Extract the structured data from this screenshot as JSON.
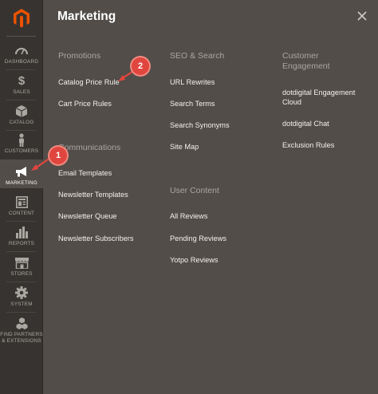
{
  "sidebar": {
    "items": [
      {
        "label": "DASHBOARD",
        "icon": "dashboard-icon"
      },
      {
        "label": "SALES",
        "icon": "dollar-icon"
      },
      {
        "label": "CATALOG",
        "icon": "box-icon"
      },
      {
        "label": "CUSTOMERS",
        "icon": "person-icon"
      },
      {
        "label": "MARKETING",
        "icon": "megaphone-icon"
      },
      {
        "label": "CONTENT",
        "icon": "content-icon"
      },
      {
        "label": "REPORTS",
        "icon": "bar-chart-icon"
      },
      {
        "label": "STORES",
        "icon": "store-icon"
      },
      {
        "label": "SYSTEM",
        "icon": "gear-icon"
      },
      {
        "label_line1": "FIND PARTNERS",
        "label_line2": "& EXTENSIONS",
        "icon": "cubes-icon"
      }
    ]
  },
  "panel": {
    "title": "Marketing",
    "promotions": {
      "title": "Promotions",
      "links": [
        "Catalog Price Rule",
        "Cart Price Rules"
      ]
    },
    "communications": {
      "title": "Communications",
      "links": [
        "Email Templates",
        "Newsletter Templates",
        "Newsletter Queue",
        "Newsletter Subscribers"
      ]
    },
    "seo": {
      "title": "SEO & Search",
      "links": [
        "URL Rewrites",
        "Search Terms",
        "Search Synonyms",
        "Site Map"
      ]
    },
    "user_content": {
      "title": "User Content",
      "links": [
        "All Reviews",
        "Pending Reviews",
        "Yotpo Reviews"
      ]
    },
    "customer_engagement": {
      "title_line1": "Customer",
      "title_line2": "Engagement",
      "links": [
        "dotdigital Engagement Cloud",
        "dotdigital Chat",
        "Exclusion Rules"
      ]
    }
  },
  "callouts": {
    "one": "1",
    "two": "2"
  },
  "colors": {
    "accent": "#e0463e",
    "sidebar_bg": "#373330",
    "panel_bg": "#524d49",
    "logo": "#eb5202"
  }
}
